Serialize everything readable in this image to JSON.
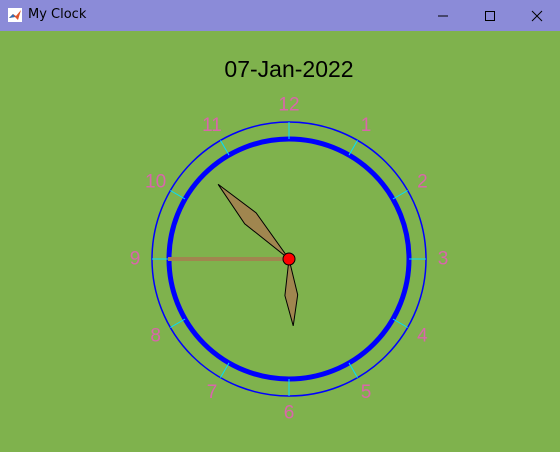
{
  "window": {
    "title": "My Clock",
    "icon": "matlab-logo-icon"
  },
  "controls": {
    "minimize": "minimize-icon",
    "maximize": "maximize-icon",
    "close": "close-icon"
  },
  "date_text": "07-Jan-2022",
  "clock": {
    "numbers": [
      "12",
      "1",
      "2",
      "3",
      "4",
      "5",
      "6",
      "7",
      "8",
      "9",
      "10",
      "11"
    ],
    "time": {
      "hour": 5,
      "minute": 52,
      "second": 45
    },
    "colors": {
      "background": "#7fb24d",
      "dial": "#0000ff",
      "ticks": "#00e0ff",
      "numbers": "#d966aa",
      "hands": "#a0864f",
      "hub": "#ff0000"
    }
  }
}
